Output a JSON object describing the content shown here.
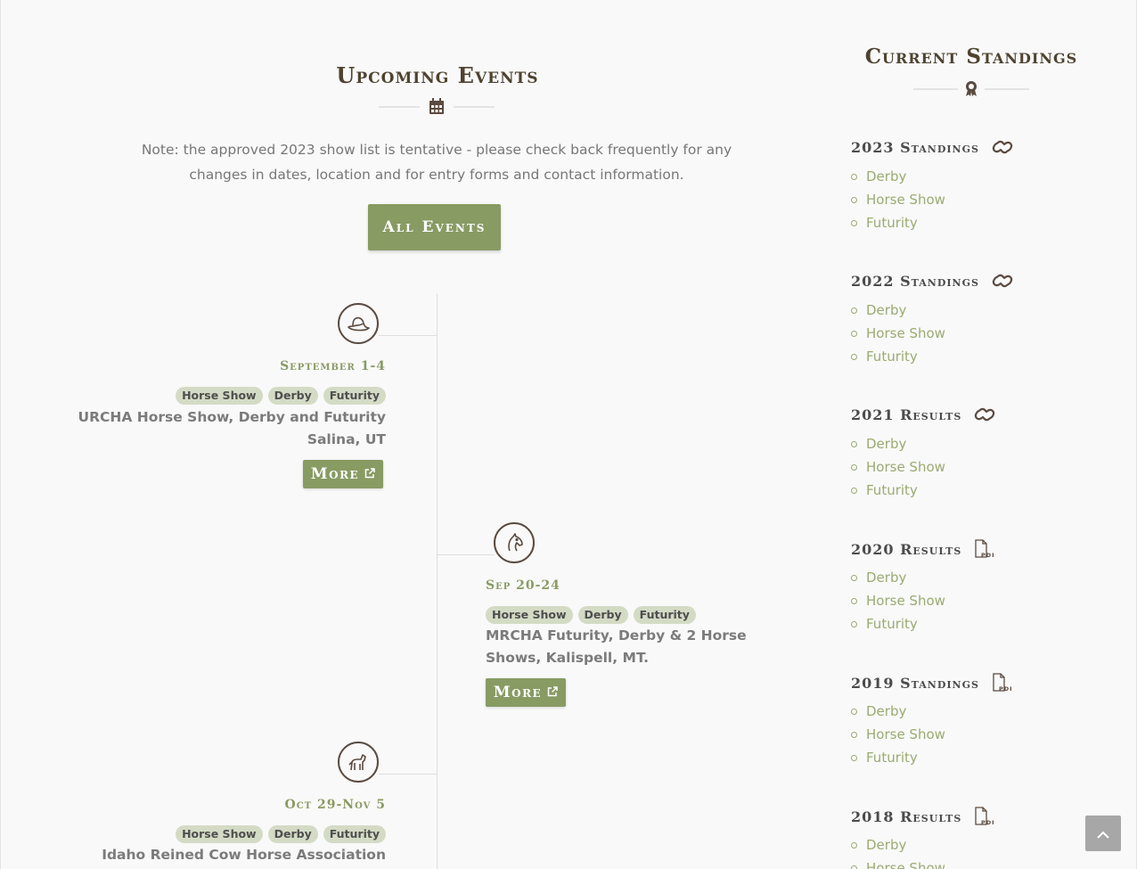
{
  "upcoming": {
    "title": "Upcoming Events",
    "icon": "calendar-icon",
    "note": "Note: the approved 2023 show list is tentative - please check back frequently for any changes in dates, location and for entry forms and contact information.",
    "all_events_label": "All Events"
  },
  "events": [
    {
      "icon": "cowboy-hat-icon",
      "date": "September 1-4",
      "tags": [
        "Horse Show",
        "Derby",
        "Futurity"
      ],
      "title_line1": "URCHA Horse Show, Derby and Futurity",
      "title_line2": "Salina, UT",
      "more_label": "More"
    },
    {
      "icon": "horse-head-icon",
      "date": "Sep 20-24",
      "tags": [
        "Horse Show",
        "Derby",
        "Futurity"
      ],
      "title_line1": "MRCHA Futurity, Derby & 2 Horse",
      "title_line2": "Shows, Kalispell, MT.",
      "more_label": "More"
    },
    {
      "icon": "horse-icon",
      "date": "Oct 29-Nov 5",
      "tags": [
        "Horse Show",
        "Derby",
        "Futurity"
      ],
      "title_line1": "Idaho Reined Cow Horse Association"
    }
  ],
  "standings": {
    "title": "Current Standings",
    "icon": "award-ribbon-icon",
    "groups": [
      {
        "heading": "2023 Standings",
        "icon": "link-icon",
        "items": [
          "Derby",
          "Horse Show",
          "Futurity"
        ]
      },
      {
        "heading": "2022 Standings",
        "icon": "link-icon",
        "items": [
          "Derby",
          "Horse Show",
          "Futurity"
        ]
      },
      {
        "heading": "2021 Results",
        "icon": "link-icon",
        "items": [
          "Derby",
          "Horse Show",
          "Futurity"
        ]
      },
      {
        "heading": "2020 Results",
        "icon": "pdf-file-icon",
        "items": [
          "Derby",
          "Horse Show",
          "Futurity"
        ]
      },
      {
        "heading": "2019 Standings",
        "icon": "pdf-file-icon",
        "items": [
          "Derby",
          "Horse Show",
          "Futurity"
        ]
      },
      {
        "heading": "2018 Results",
        "icon": "pdf-file-icon",
        "items": [
          "Derby",
          "Horse Show"
        ]
      }
    ]
  },
  "colors": {
    "accent": "#889b63",
    "heading": "#4e4330",
    "tag_bg": "#d4dbc5",
    "link": "#9aab72"
  }
}
